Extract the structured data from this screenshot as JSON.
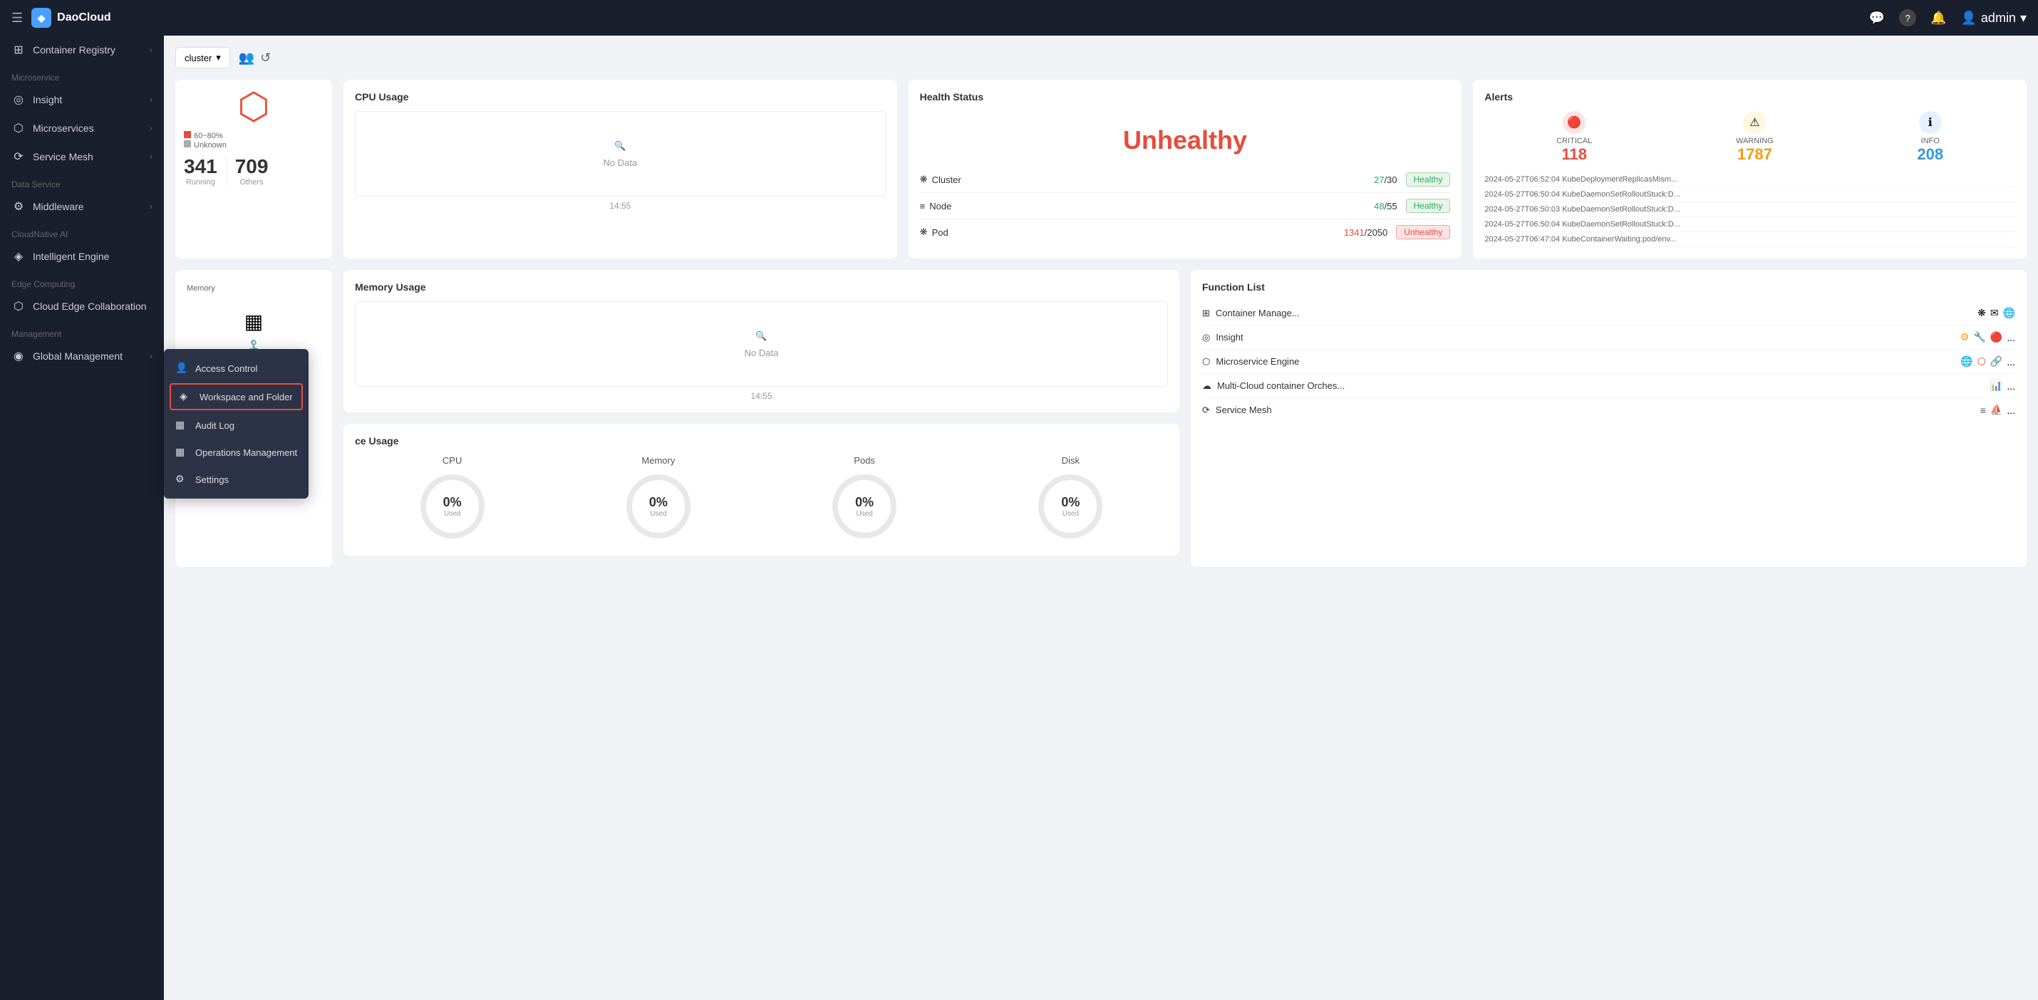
{
  "topbar": {
    "menu_icon": "☰",
    "logo_text": "DaoCloud",
    "logo_icon": "◈",
    "msg_icon": "💬",
    "help_icon": "?",
    "bell_icon": "🔔",
    "user_icon": "👤",
    "username": "admin",
    "arrow_icon": "▾"
  },
  "sidebar": {
    "sections": [
      {
        "items": [
          {
            "id": "container-registry",
            "label": "Container Registry",
            "icon": "⊞",
            "hasArrow": true
          }
        ]
      },
      {
        "sectionLabel": "Microservice",
        "items": [
          {
            "id": "insight",
            "label": "Insight",
            "icon": "◎",
            "hasArrow": true
          },
          {
            "id": "microservices",
            "label": "Microservices",
            "icon": "⬡",
            "hasArrow": true
          },
          {
            "id": "service-mesh",
            "label": "Service Mesh",
            "icon": "⟳",
            "hasArrow": true
          }
        ]
      },
      {
        "sectionLabel": "Data Service",
        "items": [
          {
            "id": "middleware",
            "label": "Middleware",
            "icon": "⚙",
            "hasArrow": true
          }
        ]
      },
      {
        "sectionLabel": "CloudNative AI",
        "items": [
          {
            "id": "intelligent-engine",
            "label": "Intelligent Engine",
            "icon": "◈",
            "hasArrow": false
          }
        ]
      },
      {
        "sectionLabel": "Edge Computing",
        "items": [
          {
            "id": "cloud-edge",
            "label": "Cloud Edge Collaboration",
            "icon": "⬡",
            "hasArrow": false
          }
        ]
      },
      {
        "sectionLabel": "Management",
        "items": [
          {
            "id": "global-management",
            "label": "Global Management",
            "icon": "◉",
            "hasArrow": true
          }
        ]
      }
    ]
  },
  "dashboard": {
    "cluster_label": "cluster",
    "cpu_usage_title": "CPU Usage",
    "no_data": "No Data",
    "time_label_1": "14:55",
    "memory_usage_title": "Memory Usage",
    "time_label_2": "14:55",
    "health_status_title": "Health Status",
    "health_status": "Unhealthy",
    "health_rows": [
      {
        "icon": "❋",
        "name": "Cluster",
        "count": "27/30",
        "count_ok": "27",
        "count_total": "30",
        "status": "Healthy"
      },
      {
        "icon": "≡",
        "name": "Node",
        "count": "48/55",
        "count_ok": "48",
        "count_total": "55",
        "status": "Healthy"
      },
      {
        "icon": "❋",
        "name": "Pod",
        "count": "1341/2050",
        "count_ok": "1341",
        "count_total": "2050",
        "status": "Unhealthy"
      }
    ],
    "alerts_title": "Alerts",
    "alerts": {
      "critical": {
        "label": "CRITICAL",
        "count": "118",
        "icon": "🔴"
      },
      "warning": {
        "label": "WARNING",
        "count": "1787",
        "icon": "⚠"
      },
      "info": {
        "label": "INFO",
        "count": "208",
        "icon": "ℹ"
      }
    },
    "alert_list": [
      "2024-05-27T06:52:04 KubeDeploymentReplicasMism...",
      "2024-05-27T06:50:04 KubeDaemonSetRolloutStuck:D...",
      "2024-05-27T06:50:03 KubeDaemonSetRolloutStuck:D...",
      "2024-05-27T06:50:04 KubeDaemonSetRolloutStuck:D...",
      "2024-05-27T06:47:04 KubeContainerWaiting:pod/env..."
    ],
    "resource_section_title": "ce Usage",
    "resources": [
      {
        "label": "CPU",
        "pct": "0%",
        "sub": "Used"
      },
      {
        "label": "Memory",
        "pct": "0%",
        "sub": "Used"
      },
      {
        "label": "Pods",
        "pct": "0%",
        "sub": "Used"
      },
      {
        "label": "Disk",
        "pct": "0%",
        "sub": "Used"
      }
    ],
    "function_list_title": "Function List",
    "functions": [
      {
        "name": "Container Manage...",
        "icon": "⊞",
        "extras": [
          "❋",
          "✉",
          "🌐"
        ]
      },
      {
        "name": "Insight",
        "icon": "◎",
        "extras": [
          "⚙",
          "🔧",
          "🔴",
          "..."
        ]
      },
      {
        "name": "Microservice Engine",
        "icon": "⬡",
        "extras": [
          "🌐",
          "⬡",
          "🔗",
          "..."
        ]
      },
      {
        "name": "Multi-Cloud container Orches...",
        "icon": "☁",
        "extras": [
          "📊",
          "..."
        ]
      },
      {
        "name": "Service Mesh",
        "icon": "⟳",
        "extras": [
          "≡",
          "⛵",
          "..."
        ]
      }
    ],
    "stats": {
      "legend_60_80": "60~80%",
      "legend_unknown": "Unknown",
      "running_label": "Running",
      "running_val": "341",
      "others_label": "Others",
      "others_val": "709"
    }
  },
  "dropdown": {
    "items": [
      {
        "id": "access-control",
        "label": "Access Control",
        "icon": "👤"
      },
      {
        "id": "workspace-folder",
        "label": "Workspace and Folder",
        "icon": "◈",
        "active": true
      },
      {
        "id": "audit-log",
        "label": "Audit Log",
        "icon": "▦"
      },
      {
        "id": "operations-management",
        "label": "Operations Management",
        "icon": "▦"
      },
      {
        "id": "settings",
        "label": "Settings",
        "icon": "⚙"
      }
    ]
  }
}
